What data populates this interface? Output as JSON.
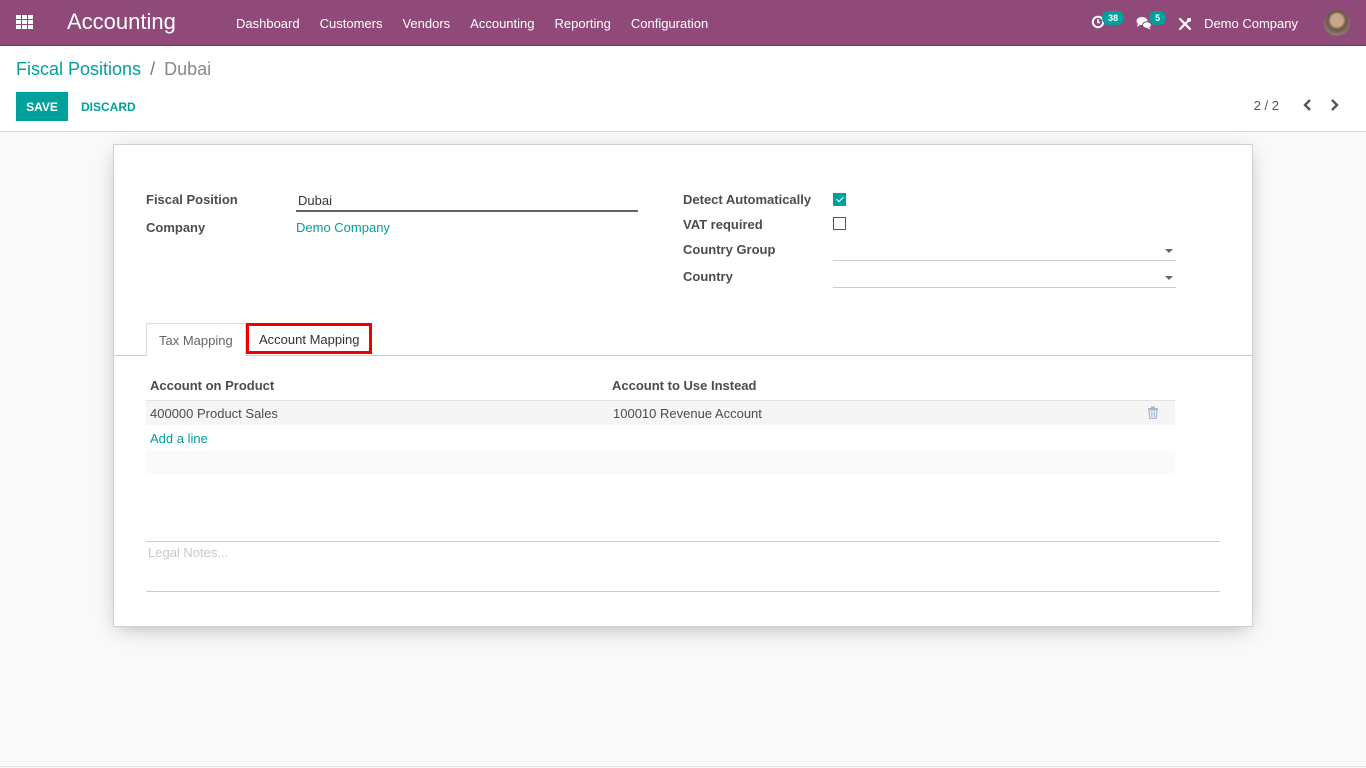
{
  "navbar": {
    "app_title": "Accounting",
    "menu": [
      "Dashboard",
      "Customers",
      "Vendors",
      "Accounting",
      "Reporting",
      "Configuration"
    ],
    "activity_count": "38",
    "messages_count": "5",
    "company": "Demo Company",
    "colors": {
      "bar": "#8f4a79",
      "badge": "#00a09d"
    }
  },
  "control_panel": {
    "breadcrumb_parent": "Fiscal Positions",
    "breadcrumb_separator": "/",
    "breadcrumb_current": "Dubai",
    "save_label": "SAVE",
    "discard_label": "DISCARD",
    "pager": "2 / 2"
  },
  "form": {
    "fiscal_position_label": "Fiscal Position",
    "fiscal_position_value": "Dubai",
    "company_label": "Company",
    "company_value": "Demo Company",
    "detect_automatically_label": "Detect Automatically",
    "detect_automatically_checked": true,
    "vat_required_label": "VAT required",
    "vat_required_checked": false,
    "country_group_label": "Country Group",
    "country_group_value": "",
    "country_label": "Country",
    "country_value": ""
  },
  "tabs": [
    {
      "label": "Tax Mapping",
      "active": false
    },
    {
      "label": "Account Mapping",
      "active": true,
      "highlighted": true
    }
  ],
  "account_mapping": {
    "columns": [
      "Account on Product",
      "Account to Use Instead"
    ],
    "rows": [
      [
        "400000 Product Sales",
        "100010 Revenue Account"
      ]
    ],
    "add_line_label": "Add a line"
  },
  "notes": {
    "placeholder": "Legal Notes...",
    "value": ""
  },
  "accent_color": "#00a09d"
}
